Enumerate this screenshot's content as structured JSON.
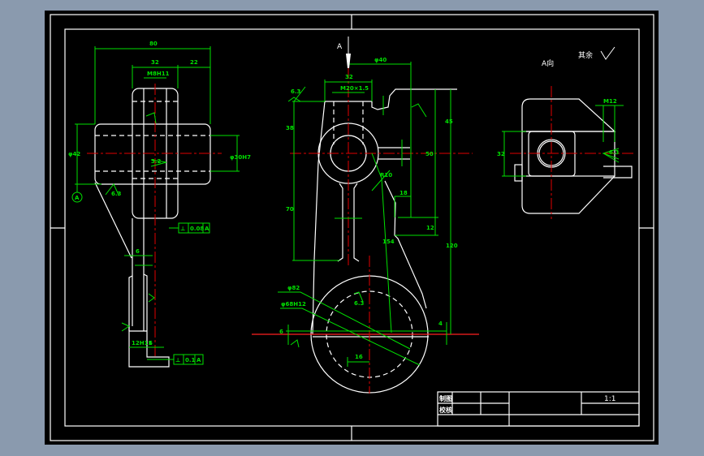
{
  "drawing": {
    "view_label": "A",
    "view_a_label": "A向",
    "surface_note": "其余",
    "colors": {
      "background": "#8a9aae",
      "canvas": "#000000",
      "outline": "#ffffff",
      "dimension": "#00e000",
      "centerline": "#e00000"
    },
    "left_view": {
      "dims": [
        "80",
        "32",
        "22",
        "M8H11",
        "φ42",
        "φ30H7",
        "3.2",
        "6.3",
        "6",
        "12H11",
        "6"
      ],
      "datum": "A",
      "tolerance_1": {
        "symbol": "⊥",
        "value": "0.08",
        "datum": "A"
      },
      "tolerance_2": {
        "symbol": "⊥",
        "value": "0.1",
        "datum": "A"
      }
    },
    "front_view": {
      "dims": [
        "φ40",
        "32",
        "M20×1.5",
        "6.3",
        "38",
        "70",
        "45",
        "50",
        "18",
        "12",
        "120",
        "R10",
        "154",
        "φ82",
        "φ68H12",
        "6.3",
        "16",
        "4",
        "6"
      ]
    },
    "right_view": {
      "dims": [
        "32",
        "M12",
        "6.3"
      ]
    },
    "title_block": {
      "row1_label": "制图",
      "row2_label": "校核",
      "scale": "1:1"
    }
  }
}
